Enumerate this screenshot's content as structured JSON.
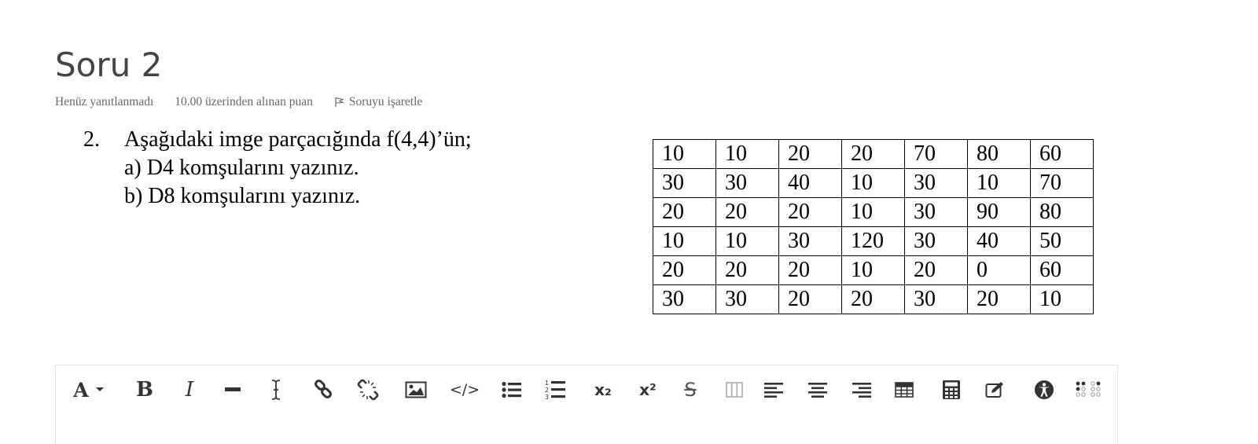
{
  "question": {
    "title": "Soru 2",
    "status": "Henüz yanıtlanmadı",
    "grade": "10.00 üzerinden alınan puan",
    "flag_label": "Soruyu işaretle",
    "number": "2.",
    "line1": "Aşağıdaki imge parçacığında f(4,4)’ün;",
    "line2": "a) D4 komşularını yazınız.",
    "line3": "b) D8 komşularını yazınız."
  },
  "image_table": {
    "rows": [
      [
        "10",
        "10",
        "20",
        "20",
        "70",
        "80",
        "60"
      ],
      [
        "30",
        "30",
        "40",
        "10",
        "30",
        "10",
        "70"
      ],
      [
        "20",
        "20",
        "20",
        "10",
        "30",
        "90",
        "80"
      ],
      [
        "10",
        "10",
        "30",
        "120",
        "30",
        "40",
        "50"
      ],
      [
        "20",
        "20",
        "20",
        "10",
        "20",
        "0",
        "60"
      ],
      [
        "30",
        "30",
        "20",
        "20",
        "30",
        "20",
        "10"
      ]
    ]
  },
  "toolbar": {
    "buttons": [
      {
        "icon": "font-color-icon",
        "glyph": "A"
      },
      {
        "icon": "bold-icon",
        "glyph": "B"
      },
      {
        "icon": "italic-icon",
        "glyph": "I"
      },
      {
        "icon": "horizontal-rule-icon"
      },
      {
        "icon": "cursor-icon"
      },
      {
        "icon": "link-icon"
      },
      {
        "icon": "unlink-icon"
      },
      {
        "icon": "image-icon"
      },
      {
        "icon": "code-icon",
        "glyph": "</>"
      },
      {
        "icon": "bullet-list-icon"
      },
      {
        "icon": "numbered-list-icon"
      },
      {
        "icon": "subscript-icon",
        "glyph": "x₂"
      },
      {
        "icon": "superscript-icon",
        "glyph": "x²"
      },
      {
        "icon": "strikethrough-icon",
        "glyph": "S"
      },
      {
        "icon": "columns-icon"
      },
      {
        "icon": "align-left-icon"
      },
      {
        "icon": "align-center-icon"
      },
      {
        "icon": "align-right-icon"
      },
      {
        "icon": "table-icon"
      },
      {
        "icon": "calculator-icon"
      },
      {
        "icon": "edit-icon"
      },
      {
        "icon": "accessibility-icon"
      },
      {
        "icon": "braille-icon"
      }
    ]
  }
}
